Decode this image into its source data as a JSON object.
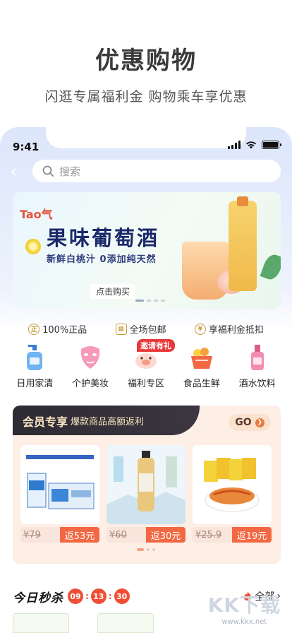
{
  "promo": {
    "title": "优惠购物",
    "subtitle": "闪逛专属福利金  购物乘车享优惠"
  },
  "status_bar": {
    "time": "9:41"
  },
  "search": {
    "placeholder": "搜索"
  },
  "banner": {
    "logo": "Tao气",
    "title": "果味葡萄酒",
    "subtitle": "新鲜白桃汁  0添加纯天然",
    "cta": "点击购买"
  },
  "perks": [
    {
      "icon": "yuan-coin-icon",
      "label": "100%正品"
    },
    {
      "icon": "package-icon",
      "label": "全场包邮"
    },
    {
      "icon": "yen-coin-icon",
      "label": "享福利金抵扣"
    }
  ],
  "categories": [
    {
      "icon": "lotion-bottle-icon",
      "label": "日用家清"
    },
    {
      "icon": "face-mask-icon",
      "label": "个护美妆"
    },
    {
      "icon": "piggy-icon",
      "label": "福利专区",
      "badge": "邀请有礼"
    },
    {
      "icon": "fruit-basket-icon",
      "label": "食品生鲜"
    },
    {
      "icon": "liquor-bottle-icon",
      "label": "酒水饮料"
    }
  ],
  "member": {
    "title": "会员专享",
    "subtitle": "爆款商品高额返利",
    "go_label": "GO",
    "products": [
      {
        "name": "milk-carton-box",
        "original_price": "¥79",
        "rebate": "返53元"
      },
      {
        "name": "oolong-tea-bottle",
        "original_price": "¥60",
        "rebate": "返30元"
      },
      {
        "name": "spicy-snack-packs",
        "original_price": "¥25.9",
        "rebate": "返19元"
      }
    ]
  },
  "flash_sale": {
    "title": "今日秒杀",
    "timer": [
      "09",
      "13",
      "30"
    ],
    "all_label": "全部"
  },
  "watermark": {
    "main": "KK下载",
    "url": "www.kkx.net"
  },
  "colors": {
    "accent": "#f26843",
    "gold": "#c79a34",
    "dark_header": "#2d2b33",
    "member_bg": "#fdeee6",
    "badge_red": "#e8383a"
  }
}
